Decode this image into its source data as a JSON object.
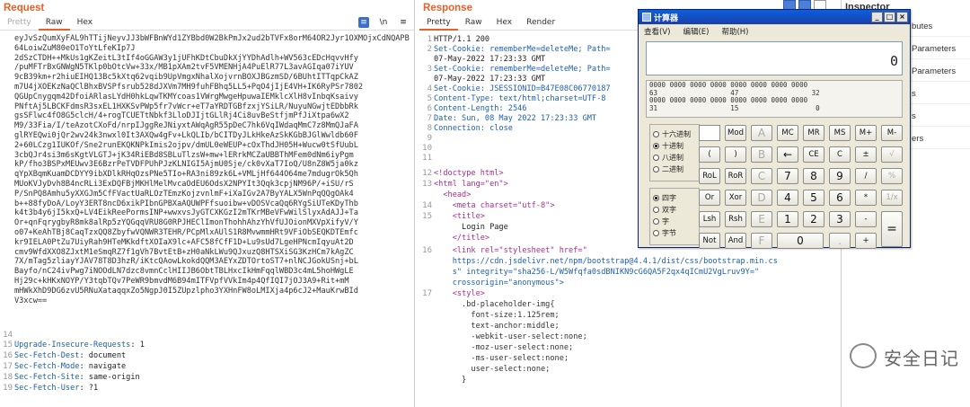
{
  "request": {
    "title": "Request",
    "tabs": [
      "Pretty",
      "Raw",
      "Hex"
    ],
    "tab_icons": [
      "≡",
      "\\n",
      "≡"
    ],
    "cookie_blob": "eyJvSzQumXyFAL9hTTijNeyvJJ3bWFBnWYd1ZYBbd0W2BkPmJx2ud2bTVFx8orM64OR2Jyr1OXMOjxCdNQAPB64LoiwZuM80eO1ToYtLfeKIp7J\n2dSzCTDH++MkUs1gKZeitL3tIf4oGGAW3y1jUFhKDtCbuDkXjYYDhAdlh+WV563cEDcHqvvHfy\n/puMFTrBxGNWgN5TKlp0bOtcVw+33x/MB1pXAm2tvF5VMENHjA4PuElR77L3avAGIqa07iYUV\n9cB39km+r2hiuEIHQ13Bc5kXtq62vqib9UpVmgxNhalXojvrnBOXJBGzmSD/6BUhtITTqpCkAZ\nm7U4jXOEKzNaQClBhxBVSPfsrub528dJXVm7MH9fuhFBhq5LL5+PqO4jIjE4VH+IK6RyPSr7802\nQGUpCnygqm42DfoiARlasLYdH0hkLqwTKMYcoas1VWrgMwgeHpuwaIEMklcXlH8vInbqKsaivy\nPNftAj5LBCKFdmsR3sxEL1HXKSvPWp5fr7vWcr+eT7aYRDTGBfzxjYSiLR/NuyuNGwjtEDbbRk\ngsSFlwc4fO8G5clcH/4+rogTCUETtNbkf3LloDJIjtGLlRj4Ci8uvBeStfjmPfJiXtpa6wX2\nM9/33Fia/I/teAzotCXoFd/nrpIJggReJNiyxtAWqAgR55pDeC7hk6VqIWdaqMmC7z8MmQJaFA\nglRYEQwi0jQr2wv24k3nwxl0It3AXQw4gFv+LkQLIb/bCITDyJLkHkeAzSkKGbBJGlWwldb60F\n2+60LCzg1IUKOf/Sne2runEKQKNPkImis2ojpv/dmUL0eWEUP+cOxThdJH05H+Wucw0tSfUubL\n3cbQJr4si3m6sKgtVLGTJ+jK34RiEBd8SBLuTlzsW+mw+lERrkMCZaUBBThMFem0dNm6iyPgm\nkP/fho3BSPxMEUwv3E6BzrPeTVDFPUhPJzKLNIGI5AjmU0Sje/ck0vXaT7IoQ/U8nZ8W5ja0kz\nqYpXBqmKuamDCDYY9ibXDlkRHqOzsPNe5TIo+RA3ni89zk6L+VMLjHf644O64me7mdugrOk5Qh\nMUoKVJyDvh8B4ncRLi3ExDQFBjMKHlMelMvcaOdEU6OdsX2NPYIt3Qqk3cpjNM96P/+iSU/rS\nP/SnPQ8Amhu5yXXGJm5CfFVactUaRLOzTEmzKojzvnlmF+iXaIGv2A7ByYALX5WnPqQQgOAk4\nb++88fyDoA/LoyY3ERT8ncD6xikPIbnGPBXaAQUWPFfsuoibw+vDOSVcaQq6RYgSiUTeKDyThb\nk4t3b4y6jI5kxQ+LV4EikReePormsINP+wwxvsJyGTCXKGzI2mTKrMBeVFwWilSlyxAdAJJ+Ta\nOr+qnFqrygbyR8mk8alRp5zYQGqqVRU8G0RPJHEClImonThohhAhzYhVfUJOionMXVpXifyV/Y\no07+KeAhTBj8CaqTzxQQ8ZbyfwVQNWR3TEHR/PCpMlxAUlS1R8MvwmmHRt9VFiObSEQKDTEmfc\nkr9IELA0PtZu7UiyRah9HTeMKkdftXOIaX9lc+AFC58fCfF1D+Lu9sUd7LgeHPNcmIqyuAt2D\ncmv9WfdXXO8ZJxtM1eSmqRZ7f1gVh7BvtEtB+zH0aNkLWu9QJxuzQ8HTSXiSG3KzHCm7kAgZC\n7X/mTag5zliayYJAV78T8D3hzR/iKtcQAowLkokdQQM3AEYxZDTOrtoST7+nlNCJGokUSnj+bL\nBayfo/nC24ivPwg7iNOOdLN7dzc8vmnCclHIIJB6ObtTBLHxcIkHmFqqlWBD3c4mL5hoHWgLE\nHj29c+kHKxNOYP/Y3tqbTQv7PeWR9bmvdM6B94mITFVpfVVkIm4p4QfIQI7jOJ3A9+Rit+mM\nmHWkXhD9DG6zvU5RNuXataqqxZo5NgpJ0I5ZUpzlpho3YXHnFW8oLMIXja4p6cJ2+MauKrwBId\nV3xcw==",
    "lines": [
      {
        "n": "14",
        "k": "",
        "v": ""
      },
      {
        "n": "15",
        "k": "Upgrade-Insecure-Requests",
        "v": ": 1"
      },
      {
        "n": "16",
        "k": "Sec-Fetch-Dest",
        "v": ": document"
      },
      {
        "n": "17",
        "k": "Sec-Fetch-Mode",
        "v": ": navigate"
      },
      {
        "n": "18",
        "k": "Sec-Fetch-Site",
        "v": ": same-origin"
      },
      {
        "n": "19",
        "k": "Sec-Fetch-User",
        "v": ": ?1"
      }
    ]
  },
  "response": {
    "title": "Response",
    "tabs": [
      "Pretty",
      "Raw",
      "Hex",
      "Render"
    ],
    "status_line": "HTTP/1.1 200",
    "set_cookie_1": "Set-Cookie: rememberMe=deleteMe; Path=",
    "set_cookie_1_cont": "07-May-2022 17:23:33 GMT",
    "set_cookie_2": "Set-Cookie: rememberMe=deleteMe; Path=",
    "set_cookie_2_cont": "07-May-2022 17:23:33 GMT",
    "set_cookie_3": "Set-Cookie: JSESSIONID=B47E08C06770187",
    "content_type": "Content-Type: text/html;charset=UTF-8",
    "content_length": "Content-Length: 2546",
    "date": "Date: Sun, 08 May 2022 17:23:33 GMT",
    "connection": "Connection: close",
    "html_lines": [
      "<!doctype html>",
      "<html lang=\"en\">",
      "  <head>",
      "    <meta charset=\"utf-8\">",
      "    <title>",
      "      Login Page",
      "    </title>",
      "    <link rel=\"stylesheet\" href=\"",
      "    https://cdn.jsdelivr.net/npm/bootstrap@4.4.1/dist/css/bootstrap.min.cs",
      "    s\" integrity=\"sha256-L/W5Wfqfa0sdBNIKN9cG6QA5F2qx4qICmU2VgLruv9Y=\"",
      "    crossorigin=\"anonymous\">",
      "    <style>",
      "      .bd-placeholder-img{",
      "        font-size:1.125rem;",
      "        text-anchor:middle;",
      "        -webkit-user-select:none;",
      "        -moz-user-select:none;",
      "        -ms-user-select:none;",
      "        user-select:none;",
      "      }"
    ]
  },
  "inspector": {
    "title": "Inspector",
    "rows": [
      "butes",
      "Parameters",
      "Parameters",
      "s",
      "s",
      "ers"
    ]
  },
  "calculator": {
    "title": "计算器",
    "menu": [
      "查看(V)",
      "编辑(E)",
      "帮助(H)"
    ],
    "display": "0",
    "bits": "0000 0000 0000 0000 0000 0000 0000 0000\n63                  47                  32\n0000 0000 0000 0000 0000 0000 0000 0000\n31                  15                   0",
    "base_modes": [
      "十六进制",
      "十进制",
      "八进制",
      "二进制"
    ],
    "word_modes": [
      "四字",
      "双字",
      "字",
      "字节"
    ],
    "keys": {
      "r1": [
        "Mod",
        "A",
        "MC",
        "MR",
        "MS",
        "M+",
        "M-"
      ],
      "r2": [
        "(",
        ")",
        "B",
        "←",
        "CE",
        "C",
        "±",
        "√"
      ],
      "r3": [
        "RoL",
        "RoR",
        "C",
        "7",
        "8",
        "9",
        "/",
        "%"
      ],
      "r4": [
        "Or",
        "Xor",
        "D",
        "4",
        "5",
        "6",
        "*",
        "1/x"
      ],
      "r5": [
        "Lsh",
        "Rsh",
        "E",
        "1",
        "2",
        "3",
        "-",
        "="
      ],
      "r6": [
        "Not",
        "And",
        "F",
        "0",
        ".",
        "+"
      ]
    }
  },
  "watermark": "安全日记"
}
